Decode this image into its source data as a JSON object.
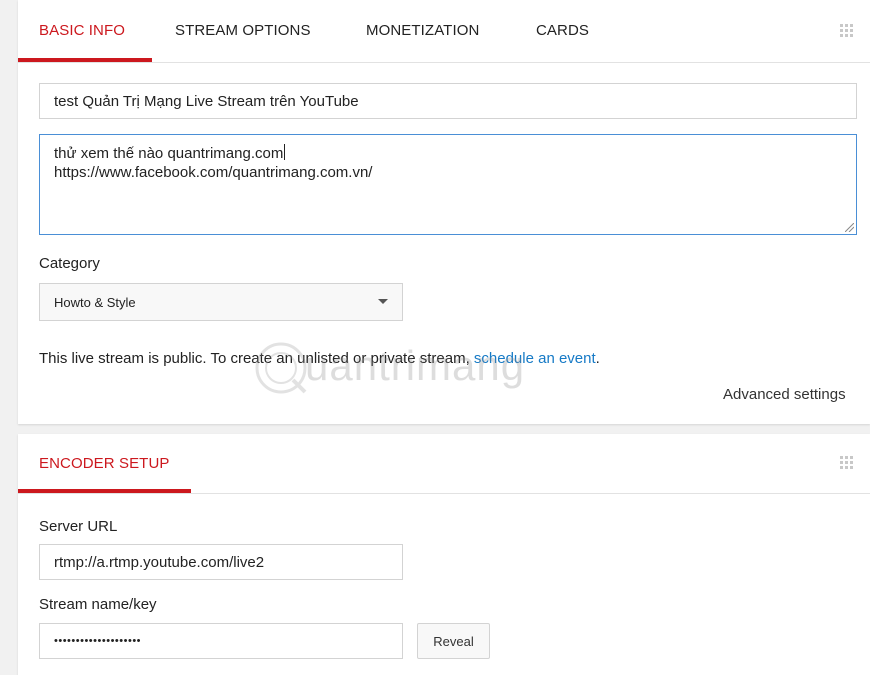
{
  "basic_card": {
    "tabs": [
      {
        "label": "BASIC INFO",
        "active": true
      },
      {
        "label": "STREAM OPTIONS",
        "active": false
      },
      {
        "label": "MONETIZATION",
        "active": false
      },
      {
        "label": "CARDS",
        "active": false
      }
    ],
    "title_value": "test Quản Trị Mạng Live Stream trên YouTube",
    "description_lines": [
      "thử xem thế nào quantrimang.com",
      "https://www.facebook.com/quantrimang.com.vn/"
    ],
    "category_label": "Category",
    "category_selected": "Howto & Style",
    "privacy_text": "This live stream is public. To create an unlisted or private stream, ",
    "privacy_link": "schedule an event",
    "privacy_end": ".",
    "advanced_settings": "Advanced settings"
  },
  "encoder_card": {
    "tab_label": "ENCODER SETUP",
    "server_url_label": "Server URL",
    "server_url_value": "rtmp://a.rtmp.youtube.com/live2",
    "stream_key_label": "Stream name/key",
    "stream_key_masked": "••••••••••••••••••••",
    "reveal_button": "Reveal"
  },
  "colors": {
    "accent": "#cc181e",
    "link": "#167ac6",
    "focus_border": "#4a8fd6"
  },
  "watermark": {
    "text": "uantrimang",
    "icon": "quantrimang-logo-icon"
  }
}
